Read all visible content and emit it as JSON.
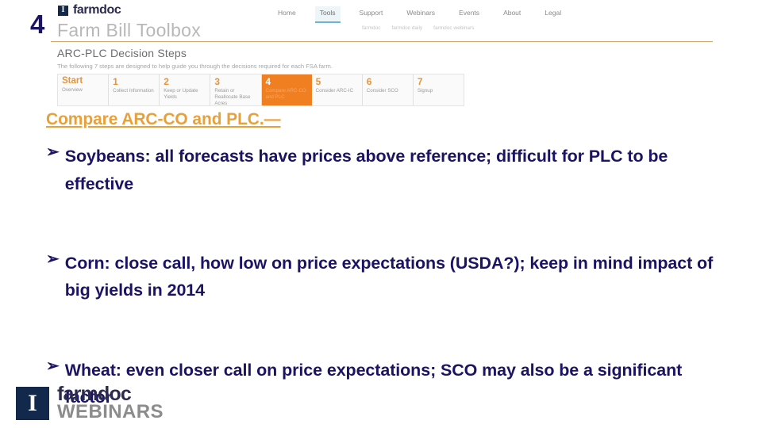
{
  "slide": {
    "number": "4"
  },
  "screenshot": {
    "brand": {
      "logo_glyph": "I",
      "name": "farmdoc",
      "site_title": "Farm Bill Toolbox"
    },
    "topnav": [
      {
        "label": "Home",
        "active": false
      },
      {
        "label": "Tools",
        "active": true
      },
      {
        "label": "Support",
        "active": false
      },
      {
        "label": "Webinars",
        "active": false
      },
      {
        "label": "Events",
        "active": false
      },
      {
        "label": "About",
        "active": false
      },
      {
        "label": "Legal",
        "active": false
      }
    ],
    "subnav": [
      {
        "label": "farmdoc"
      },
      {
        "label": "farmdoc daily"
      },
      {
        "label": "farmdoc webinars"
      }
    ],
    "steps_panel": {
      "heading": "ARC-PLC Decision Steps",
      "subheading": "The following 7 steps are designed to help guide you through the decisions required for each FSA farm.",
      "steps": [
        {
          "num": "Start",
          "label": "Overview",
          "highlight": false
        },
        {
          "num": "1",
          "label": "Collect Information",
          "highlight": false
        },
        {
          "num": "2",
          "label": "Keep or Update Yields",
          "highlight": false
        },
        {
          "num": "3",
          "label": "Retain or Reallocate Base Acres",
          "highlight": false
        },
        {
          "num": "4",
          "label": "Compare ARC-CO and PLC",
          "highlight": true
        },
        {
          "num": "5",
          "label": "Consider ARC-IC",
          "highlight": false
        },
        {
          "num": "6",
          "label": "Consider SCO",
          "highlight": false
        },
        {
          "num": "7",
          "label": "Signup",
          "highlight": false
        }
      ]
    }
  },
  "content": {
    "heading": "Compare ARC-CO and PLC.—",
    "bullet_marker": "➢",
    "bullets": [
      {
        "text": "Soybeans:  all forecasts have prices above reference; difficult for PLC to be effective"
      },
      {
        "text": "Corn:  close call, how low on price expectations (USDA?); keep in mind impact of big yields in 2014"
      },
      {
        "text": "Wheat:  even closer call on price expectations; SCO may also be a significant factor"
      }
    ]
  },
  "footer": {
    "mark_glyph": "I",
    "farmdoc": "farmdoc",
    "webinars": "WEBINARS"
  },
  "colors": {
    "navy_text": "#1b1464",
    "heading_orange": "#e8a13a",
    "step_highlight_orange": "#f07f22",
    "step_num_orange": "#e8953a",
    "brand_navy": "#13294b",
    "title_gray": "#b8b8b8"
  }
}
